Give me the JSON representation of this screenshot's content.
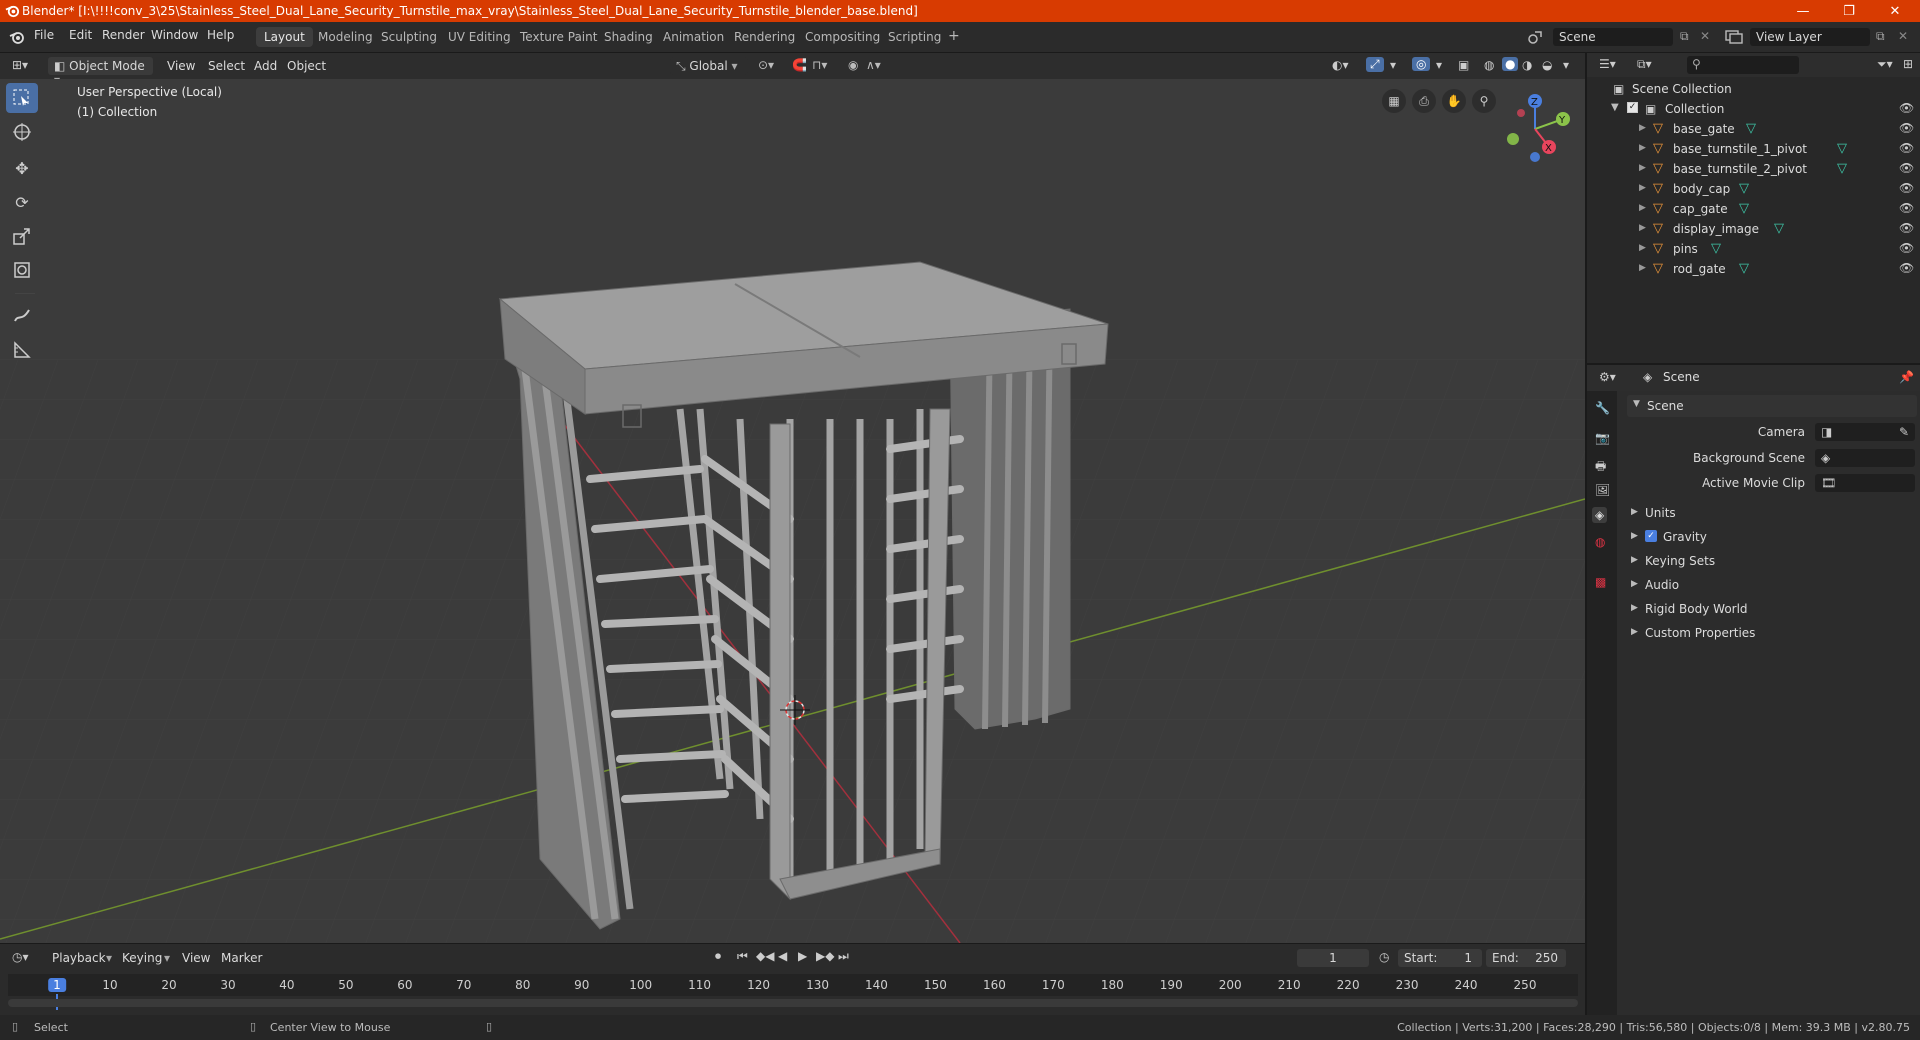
{
  "window": {
    "title": "Blender* [I:\\!!!!conv_3\\25\\Stainless_Steel_Dual_Lane_Security_Turnstile_max_vray\\Stainless_Steel_Dual_Lane_Security_Turnstile_blender_base.blend]",
    "minimize": "—",
    "maximize": "❐",
    "close": "✕"
  },
  "menubar": {
    "items": [
      "File",
      "Edit",
      "Render",
      "Window",
      "Help"
    ]
  },
  "workspaces": [
    "Layout",
    "Modeling",
    "Sculpting",
    "UV Editing",
    "Texture Paint",
    "Shading",
    "Animation",
    "Rendering",
    "Compositing",
    "Scripting"
  ],
  "active_workspace": "Layout",
  "add_workspace": "+",
  "scene_selector": "Scene",
  "view_layer_selector": "View Layer",
  "viewport_header": {
    "mode": "Object Mode",
    "menus": [
      "View",
      "Select",
      "Add",
      "Object"
    ],
    "orientation": "Global"
  },
  "viewport": {
    "perspective_label": "User Perspective (Local)",
    "collection_label": "(1) Collection",
    "gizmo_axes": [
      "Z",
      "Y",
      "X"
    ]
  },
  "outliner": {
    "search_placeholder": "",
    "root": "Scene Collection",
    "collection": "Collection",
    "objects": [
      "base_gate",
      "base_turnstile_1_pivot",
      "base_turnstile_2_pivot",
      "body_cap",
      "cap_gate",
      "display_image",
      "pins",
      "rod_gate"
    ]
  },
  "properties": {
    "header": "Scene",
    "panel_title": "Scene",
    "camera_label": "Camera",
    "background_scene_label": "Background Scene",
    "active_movie_clip_label": "Active Movie Clip",
    "sections": [
      "Units",
      "Gravity",
      "Keying Sets",
      "Audio",
      "Rigid Body World",
      "Custom Properties"
    ],
    "gravity_checked": true
  },
  "timeline": {
    "menus": [
      "Playback",
      "Keying",
      "View",
      "Marker"
    ],
    "current_frame": "1",
    "start_label": "Start:",
    "start_value": "1",
    "end_label": "End:",
    "end_value": "250",
    "ticks": [
      "1",
      "10",
      "20",
      "30",
      "40",
      "50",
      "60",
      "70",
      "80",
      "90",
      "100",
      "110",
      "120",
      "130",
      "140",
      "150",
      "160",
      "170",
      "180",
      "190",
      "200",
      "210",
      "220",
      "230",
      "240",
      "250"
    ]
  },
  "statusbar": {
    "left_action": "Select",
    "middle_action": "Center View to Mouse",
    "stats": "Collection | Verts:31,200 | Faces:28,290 | Tris:56,580 | Objects:0/8 | Mem: 39.3 MB | v2.80.75"
  },
  "colors": {
    "titlebar": "#d83b01",
    "accent": "#4a6fa5",
    "x_axis": "#e8455d",
    "y_axis": "#8bc34a",
    "z_axis": "#4a7fe0",
    "mesh_icon": "#e8943a",
    "vertex_icon": "#3ec7a8"
  }
}
